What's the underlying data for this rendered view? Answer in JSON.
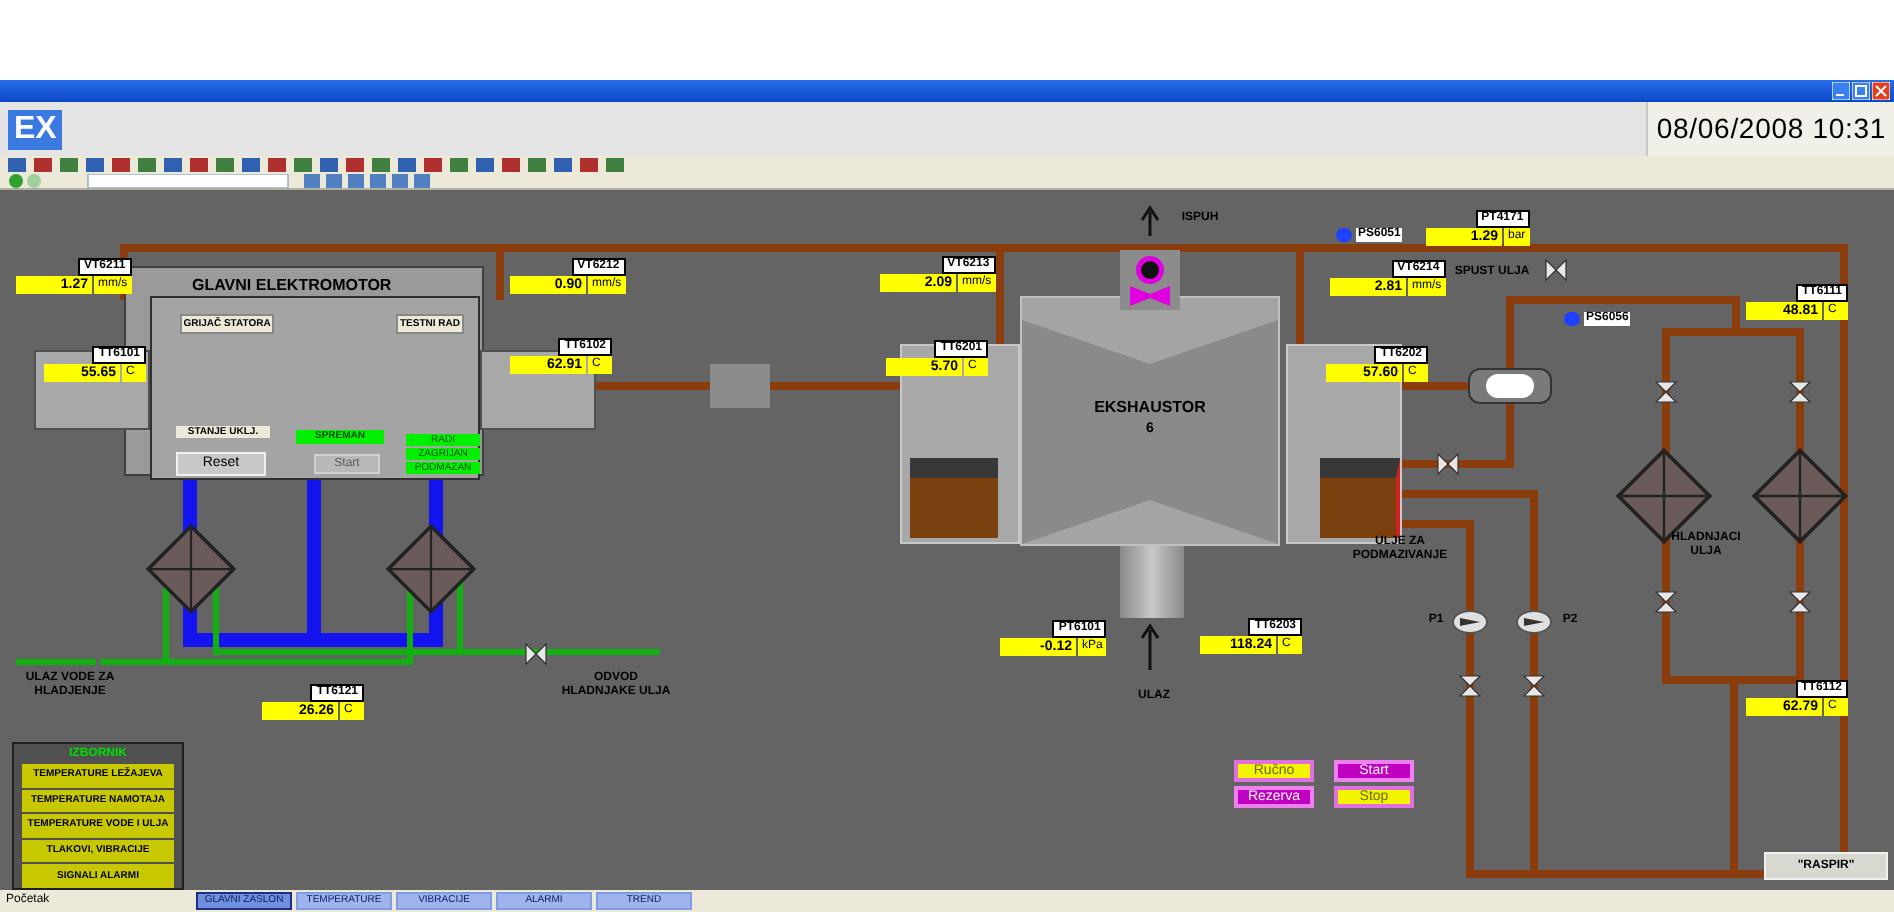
{
  "header": {
    "logo": "EX",
    "datetime": "08/06/2008 10:31"
  },
  "readouts": [
    {
      "tag": "VT6211",
      "value": "1.27",
      "unit": "mm/s"
    },
    {
      "tag": "VT6212",
      "value": "0.90",
      "unit": "mm/s"
    },
    {
      "tag": "TT6101",
      "value": "55.65",
      "unit": "C"
    },
    {
      "tag": "TT6102",
      "value": "62.91",
      "unit": "C"
    },
    {
      "tag": "VT6213",
      "value": "2.09",
      "unit": "mm/s"
    },
    {
      "tag": "TT6201",
      "value": "5.70",
      "unit": "C"
    },
    {
      "tag": "VT6214",
      "value": "2.81",
      "unit": "mm/s"
    },
    {
      "tag": "TT6202",
      "value": "57.60",
      "unit": "C"
    },
    {
      "tag": "PT4171",
      "value": "1.29",
      "unit": "bar"
    },
    {
      "tag": "TT6111",
      "value": "48.81",
      "unit": "C"
    },
    {
      "tag": "TT6121",
      "value": "26.26",
      "unit": "C"
    },
    {
      "tag": "PT6101",
      "value": "-0.12",
      "unit": "kPa"
    },
    {
      "tag": "TT6203",
      "value": "118.24",
      "unit": "C"
    },
    {
      "tag": "TT6112",
      "value": "62.79",
      "unit": "C"
    }
  ],
  "switches": [
    {
      "tag": "PS6051",
      "on": true
    },
    {
      "tag": "PS6056",
      "on": true
    }
  ],
  "labels": [
    "ISPUH",
    "SPUST ULJA",
    "ULJE ZA PODMAZIVANJE",
    "HLADNJACI ULJA",
    "ULAZ VODE ZA HLADJENJE",
    "ODVOD HLADNJAKE ULJA",
    "ULAZ",
    "P1",
    "P2"
  ],
  "motor": {
    "title": "GLAVNI ELEKTROMOTOR",
    "heater": "GRIJAČ STATORA",
    "test": "TESTNI RAD",
    "state": "STANJE UKLJ.",
    "reset": "Reset",
    "ready": {
      "label": "SPREMAN",
      "active": true
    },
    "start": {
      "label": "Start",
      "disabled": true
    },
    "indicators": [
      {
        "label": "RADI",
        "active": true
      },
      {
        "label": "ZAGRIJAN",
        "active": true
      },
      {
        "label": "PODMAZAN",
        "active": true
      }
    ]
  },
  "exhaustor": {
    "title": "EKSHAUSTOR",
    "number": "6"
  },
  "controls": [
    {
      "label": "Ručno",
      "kind": "yellow"
    },
    {
      "label": "Start",
      "kind": "magenta"
    },
    {
      "label": "Rezerva",
      "kind": "magenta"
    },
    {
      "label": "Stop",
      "kind": "yellow"
    }
  ],
  "raspir": "\"RASPIR\"",
  "menu": {
    "title": "IZBORNIK",
    "items": [
      "TEMPERATURE LEŽAJEVA",
      "TEMPERATURE NAMOTAJA",
      "TEMPERATURE VODE I ULJA",
      "TLAKOVI, VIBRACIJE",
      "SIGNALI ALARMI"
    ]
  },
  "taskbar": {
    "start": "Početak",
    "items": [
      {
        "label": "GLAVNI ZASLON",
        "selected": true
      },
      {
        "label": "TEMPERATURE",
        "selected": false
      },
      {
        "label": "VIBRACIJE",
        "selected": false
      },
      {
        "label": "ALARMI",
        "selected": false
      },
      {
        "label": "TREND",
        "selected": false
      }
    ]
  }
}
